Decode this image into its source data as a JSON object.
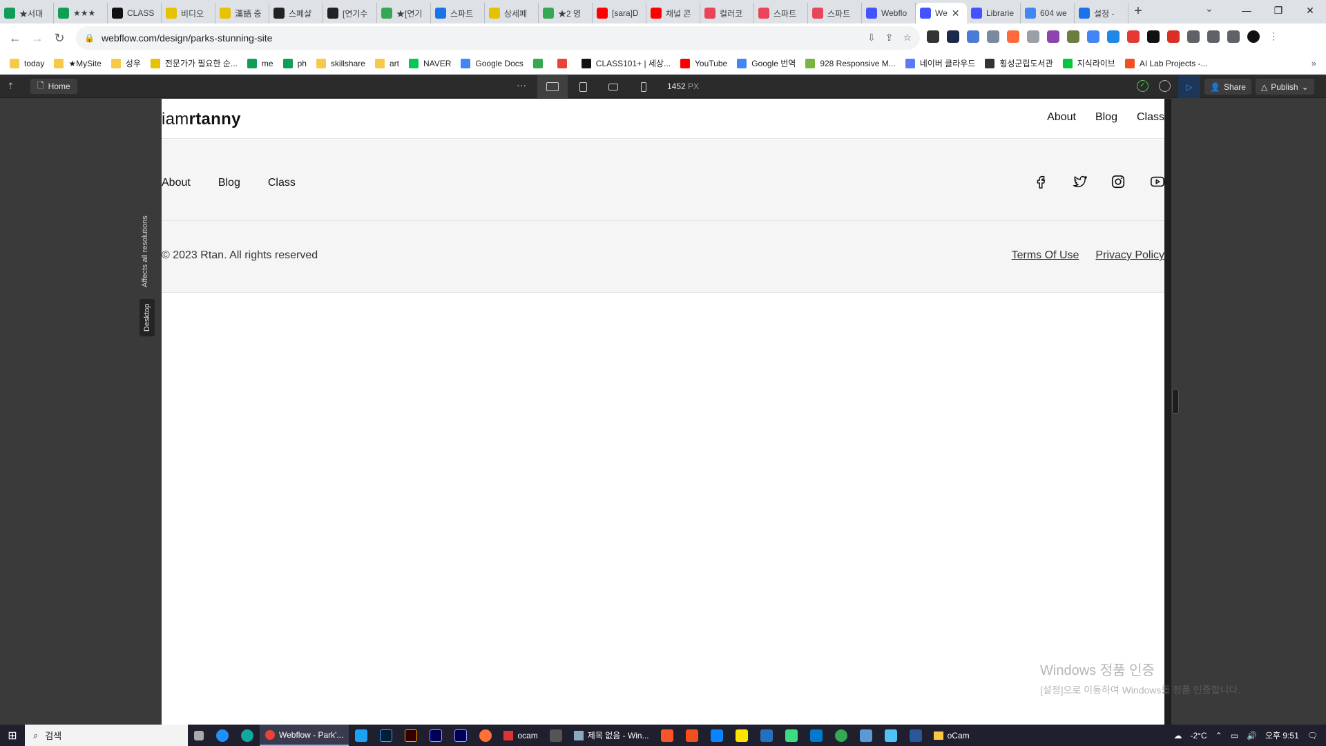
{
  "browser": {
    "tabs": [
      {
        "label": "★서대",
        "color": "#0f9d58"
      },
      {
        "label": "★★★",
        "color": "#0f9d58"
      },
      {
        "label": "CLASS",
        "color": "#111111"
      },
      {
        "label": "비디오",
        "color": "#e6c200"
      },
      {
        "label": "漢語 중",
        "color": "#e6c200"
      },
      {
        "label": "스페샬",
        "color": "#222222"
      },
      {
        "label": "[연기수",
        "color": "#222222"
      },
      {
        "label": "★[연기",
        "color": "#34a853"
      },
      {
        "label": "스파트",
        "color": "#1a73e8"
      },
      {
        "label": "상세페",
        "color": "#e6c200"
      },
      {
        "label": "★2 영",
        "color": "#34a853"
      },
      {
        "label": "[sara]D",
        "color": "#ff0000"
      },
      {
        "label": "채널 콘",
        "color": "#ff0000"
      },
      {
        "label": "컬러코",
        "color": "#e8455a"
      },
      {
        "label": "스파트",
        "color": "#e8455a"
      },
      {
        "label": "스파트",
        "color": "#e8455a"
      },
      {
        "label": "Webflo",
        "color": "#4353ff"
      },
      {
        "label": "We",
        "color": "#4353ff",
        "active": true
      },
      {
        "label": "Librarie",
        "color": "#4353ff"
      },
      {
        "label": "604 we",
        "color": "#4285f4"
      },
      {
        "label": "설정 -",
        "color": "#1a73e8"
      }
    ],
    "new_tab": "+",
    "url": "webflow.com/design/parks-stunning-site",
    "bookmarks": [
      {
        "label": "today",
        "color": "#f7c948"
      },
      {
        "label": "★MySite",
        "color": "#f7c948"
      },
      {
        "label": "성우",
        "color": "#f7c948"
      },
      {
        "label": "전문가가 필요한 순...",
        "color": "#e6c200"
      },
      {
        "label": "me",
        "color": "#0f9d58"
      },
      {
        "label": "ph",
        "color": "#0f9d58"
      },
      {
        "label": "skillshare",
        "color": "#f7c948"
      },
      {
        "label": "art",
        "color": "#f7c948"
      },
      {
        "label": "NAVER",
        "color": "#03c75a"
      },
      {
        "label": "Google Docs",
        "color": "#4285f4"
      },
      {
        "label": "",
        "color": "#34a853"
      },
      {
        "label": "",
        "color": "#ea4335"
      },
      {
        "label": "CLASS101+ | 세상...",
        "color": "#111111"
      },
      {
        "label": "YouTube",
        "color": "#ff0000"
      },
      {
        "label": "Google 번역",
        "color": "#4285f4"
      },
      {
        "label": "928 Responsive M...",
        "color": "#7cb342"
      },
      {
        "label": "네이버 클라우드",
        "color": "#5b7cf6"
      },
      {
        "label": "횡성군립도서관",
        "color": "#333333"
      },
      {
        "label": "지식라이브",
        "color": "#00c73c"
      },
      {
        "label": "AI Lab Projects -...",
        "color": "#f25022"
      }
    ],
    "bookmarks_more": "»"
  },
  "webflow": {
    "page_label": "Home",
    "more": "···",
    "canvas_width_value": "1452",
    "canvas_width_unit": "PX",
    "share_label": "Share",
    "publish_label": "Publish",
    "affects_label": "Affects all resolutions",
    "breakpoint_label": "Desktop"
  },
  "site": {
    "logo_light": "iam",
    "logo_bold": "rtanny",
    "header_nav": [
      "About",
      "Blog",
      "Class"
    ],
    "footer_nav": [
      "About",
      "Blog",
      "Class"
    ],
    "social_icons": [
      "facebook-icon",
      "twitter-icon",
      "instagram-icon",
      "youtube-icon"
    ],
    "copyright": "© 2023 Rtan. All rights reserved",
    "legal_links": [
      "Terms Of Use",
      "Privacy Policy"
    ]
  },
  "watermark": {
    "title": "Windows 정품 인증",
    "subtitle": "[설정]으로 이동하여 Windows를 정품 인증합니다."
  },
  "taskbar": {
    "search_placeholder": "검색",
    "apps": [
      {
        "label": "Webflow - Park'...",
        "active": true
      },
      {
        "label": "ocam"
      },
      {
        "label": "제목 없음 - Win..."
      },
      {
        "label": "oCam"
      }
    ],
    "temperature": "-2°C",
    "time": "오후 9:51"
  }
}
